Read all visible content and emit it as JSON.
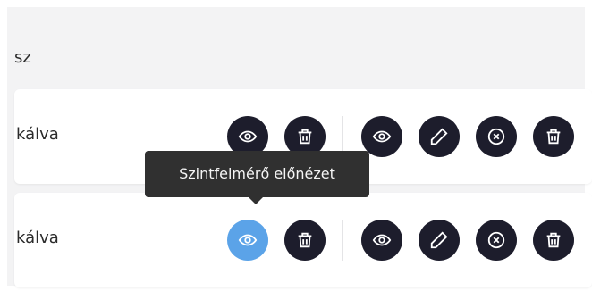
{
  "header": {
    "text": "sz"
  },
  "rows": [
    {
      "label": "kálva",
      "actions_left": [
        "eye-icon",
        "trash-icon"
      ],
      "actions_right": [
        "eye-icon",
        "pencil-icon",
        "close-circle-icon",
        "trash-icon"
      ]
    },
    {
      "label": "kálva",
      "actions_left": [
        "eye-icon",
        "trash-icon"
      ],
      "actions_right": [
        "eye-icon",
        "pencil-icon",
        "close-circle-icon",
        "trash-icon"
      ]
    }
  ],
  "tooltip": {
    "text": "Szintfelmérő előnézet"
  },
  "colors": {
    "button_dark": "#1d1d2c",
    "button_active": "#5ba3e8",
    "tooltip_bg": "#303030",
    "panel_bg": "#f3f3f4"
  }
}
